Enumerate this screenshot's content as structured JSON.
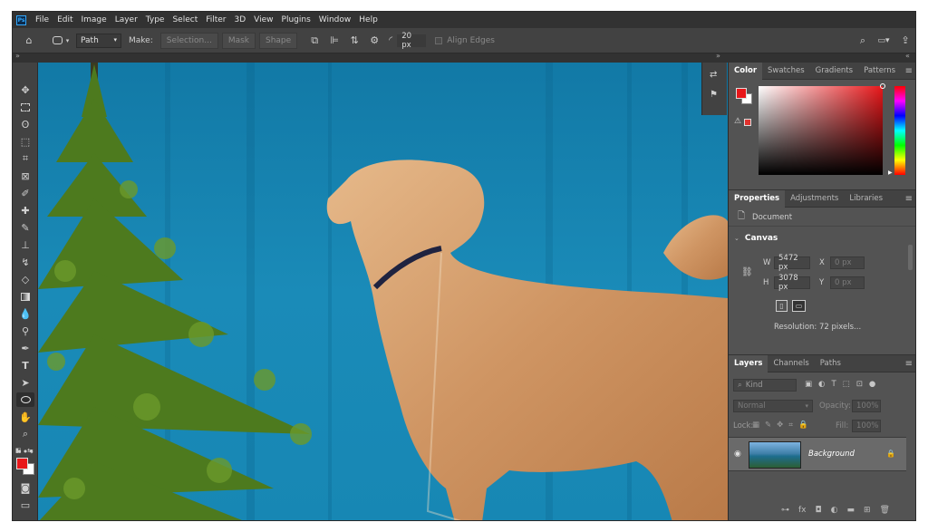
{
  "menu": [
    "File",
    "Edit",
    "Image",
    "Layer",
    "Type",
    "Select",
    "Filter",
    "3D",
    "View",
    "Plugins",
    "Window",
    "Help"
  ],
  "options": {
    "mode": "Path",
    "make_label": "Make:",
    "selection": "Selection...",
    "mask": "Mask",
    "shape": "Shape",
    "radius": "20 px",
    "align_edges": "Align Edges"
  },
  "color_panel": {
    "tabs": [
      "Color",
      "Swatches",
      "Gradients",
      "Patterns"
    ],
    "foreground": "#e8171a",
    "background": "#ffffff"
  },
  "properties": {
    "tabs": [
      "Properties",
      "Adjustments",
      "Libraries"
    ],
    "doc_label": "Document",
    "section": "Canvas",
    "w_label": "W",
    "w_value": "5472 px",
    "h_label": "H",
    "h_value": "3078 px",
    "x_label": "X",
    "x_value": "0 px",
    "y_label": "Y",
    "y_value": "0 px",
    "resolution": "Resolution: 72 pixels..."
  },
  "layers": {
    "tabs": [
      "Layers",
      "Channels",
      "Paths"
    ],
    "filter_placeholder": "Kind",
    "blend": "Normal",
    "opacity_label": "Opacity:",
    "opacity": "100%",
    "lock_label": "Lock:",
    "fill_label": "Fill:",
    "fill": "100%",
    "layer_name": "Background"
  },
  "colors": {
    "accent": "#31a8ff",
    "canvas_bg": "#1a88b6"
  }
}
